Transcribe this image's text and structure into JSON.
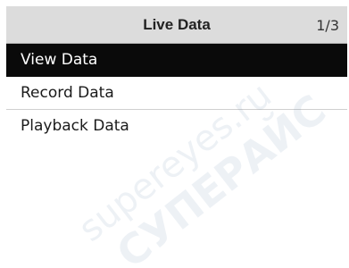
{
  "header": {
    "title": "Live Data",
    "page_indicator": "1/3"
  },
  "menu": {
    "items": [
      {
        "label": "View Data",
        "selected": true
      },
      {
        "label": "Record Data",
        "selected": false
      },
      {
        "label": "Playback Data",
        "selected": false
      }
    ]
  },
  "watermark": {
    "line1": "supereyes.ru",
    "line2": "СУПЕРАЙС"
  },
  "colors": {
    "title_bar_bg": "#dcdcdc",
    "selected_bg": "#0a0a0a",
    "selected_text": "#ffffff",
    "text": "#1a1a1a"
  }
}
